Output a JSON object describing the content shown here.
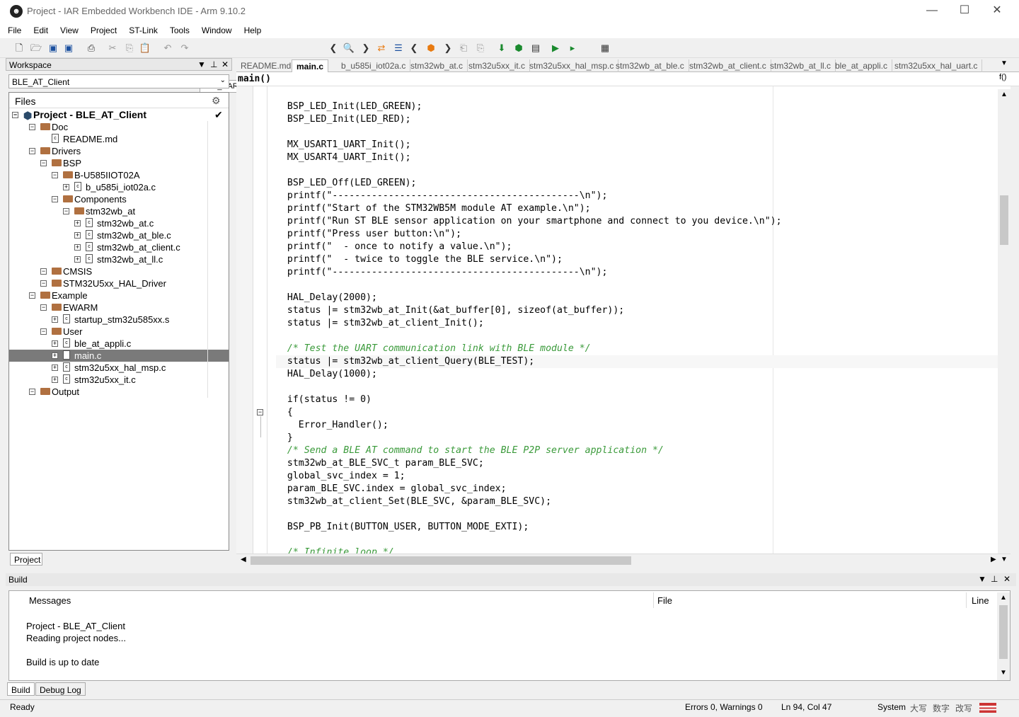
{
  "window": {
    "title": "Project - IAR Embedded Workbench IDE - Arm 9.10.2"
  },
  "menu": [
    "File",
    "Edit",
    "View",
    "Project",
    "ST-Link",
    "Tools",
    "Window",
    "Help"
  ],
  "toolbar": {
    "function_box": "HAL_UART_TxCpltCallback"
  },
  "workspace": {
    "title": "Workspace",
    "selected_config": "BLE_AT_Client",
    "files_header": "Files",
    "project_name": "Project - BLE_AT_Client",
    "tree": [
      {
        "label": "Doc",
        "type": "folder",
        "depth": 1
      },
      {
        "label": "README.md",
        "type": "file",
        "depth": 2
      },
      {
        "label": "Drivers",
        "type": "folder",
        "depth": 1
      },
      {
        "label": "BSP",
        "type": "folder",
        "depth": 2
      },
      {
        "label": "B-U585IIOT02A",
        "type": "folder",
        "depth": 3
      },
      {
        "label": "b_u585i_iot02a.c",
        "type": "file",
        "depth": 4
      },
      {
        "label": "Components",
        "type": "folder",
        "depth": 3
      },
      {
        "label": "stm32wb_at",
        "type": "folder",
        "depth": 4
      },
      {
        "label": "stm32wb_at.c",
        "type": "file",
        "depth": 5
      },
      {
        "label": "stm32wb_at_ble.c",
        "type": "file",
        "depth": 5
      },
      {
        "label": "stm32wb_at_client.c",
        "type": "file",
        "depth": 5
      },
      {
        "label": "stm32wb_at_ll.c",
        "type": "file",
        "depth": 5
      },
      {
        "label": "CMSIS",
        "type": "folder",
        "depth": 2
      },
      {
        "label": "STM32U5xx_HAL_Driver",
        "type": "folder",
        "depth": 2
      },
      {
        "label": "Example",
        "type": "folder",
        "depth": 1
      },
      {
        "label": "EWARM",
        "type": "folder",
        "depth": 2
      },
      {
        "label": "startup_stm32u585xx.s",
        "type": "file",
        "depth": 3
      },
      {
        "label": "User",
        "type": "folder",
        "depth": 2
      },
      {
        "label": "ble_at_appli.c",
        "type": "file",
        "depth": 3
      },
      {
        "label": "main.c",
        "type": "file",
        "depth": 3,
        "selected": true
      },
      {
        "label": "stm32u5xx_hal_msp.c",
        "type": "file",
        "depth": 3
      },
      {
        "label": "stm32u5xx_it.c",
        "type": "file",
        "depth": 3
      },
      {
        "label": "Output",
        "type": "folder",
        "depth": 1
      }
    ],
    "bottom_tab": "Project"
  },
  "editor": {
    "tabs": [
      "README.md",
      "main.c",
      "b_u585i_iot02a.c",
      "stm32wb_at.c",
      "stm32u5xx_it.c",
      "stm32u5xx_hal_msp.c",
      "stm32wb_at_ble.c",
      "stm32wb_at_client.c",
      "stm32wb_at_ll.c",
      "ble_at_appli.c",
      "stm32u5xx_hal_uart.c"
    ],
    "active_tab": 1,
    "function": "main()",
    "lines": [
      "  BSP_LED_Init(LED_GREEN);",
      "  BSP_LED_Init(LED_RED);",
      "",
      "  MX_USART1_UART_Init();",
      "  MX_USART4_UART_Init();",
      "",
      "  BSP_LED_Off(LED_GREEN);",
      "  printf(\"--------------------------------------------\\n\");",
      "  printf(\"Start of the STM32WB5M module AT example.\\n\");",
      "  printf(\"Run ST BLE sensor application on your smartphone and connect to you device.\\n\");",
      "  printf(\"Press user button:\\n\");",
      "  printf(\"  - once to notify a value.\\n\");",
      "  printf(\"  - twice to toggle the BLE service.\\n\");",
      "  printf(\"--------------------------------------------\\n\");",
      "",
      "  HAL_Delay(2000);",
      "  status |= stm32wb_at_Init(&at_buffer[0], sizeof(at_buffer));",
      "  status |= stm32wb_at_client_Init();",
      "",
      "  /* Test the UART communication link with BLE module */",
      "  status |= stm32wb_at_client_Query(BLE_TEST);",
      "  HAL_Delay(1000);",
      "",
      "  if(status != 0)",
      "  {",
      "    Error_Handler();",
      "  }",
      "  /* Send a BLE AT command to start the BLE P2P server application */",
      "  stm32wb_at_BLE_SVC_t param_BLE_SVC;",
      "  global_svc_index = 1;",
      "  param_BLE_SVC.index = global_svc_index;",
      "  stm32wb_at_client_Set(BLE_SVC, &param_BLE_SVC);",
      "",
      "  BSP_PB_Init(BUTTON_USER, BUTTON_MODE_EXTI);",
      "",
      "  /* Infinite loop */"
    ]
  },
  "build": {
    "title": "Build",
    "columns": [
      "Messages",
      "File",
      "Line"
    ],
    "messages": [
      "Project - BLE_AT_Client",
      "Reading project nodes...",
      "",
      "Build is up to date"
    ],
    "tabs": [
      "Build",
      "Debug Log"
    ]
  },
  "status": {
    "left": "Ready",
    "errors": "Errors 0, Warnings 0",
    "position": "Ln 94, Col 47",
    "encoding": "System",
    "ime": [
      "大写",
      "数字",
      "改写"
    ]
  }
}
